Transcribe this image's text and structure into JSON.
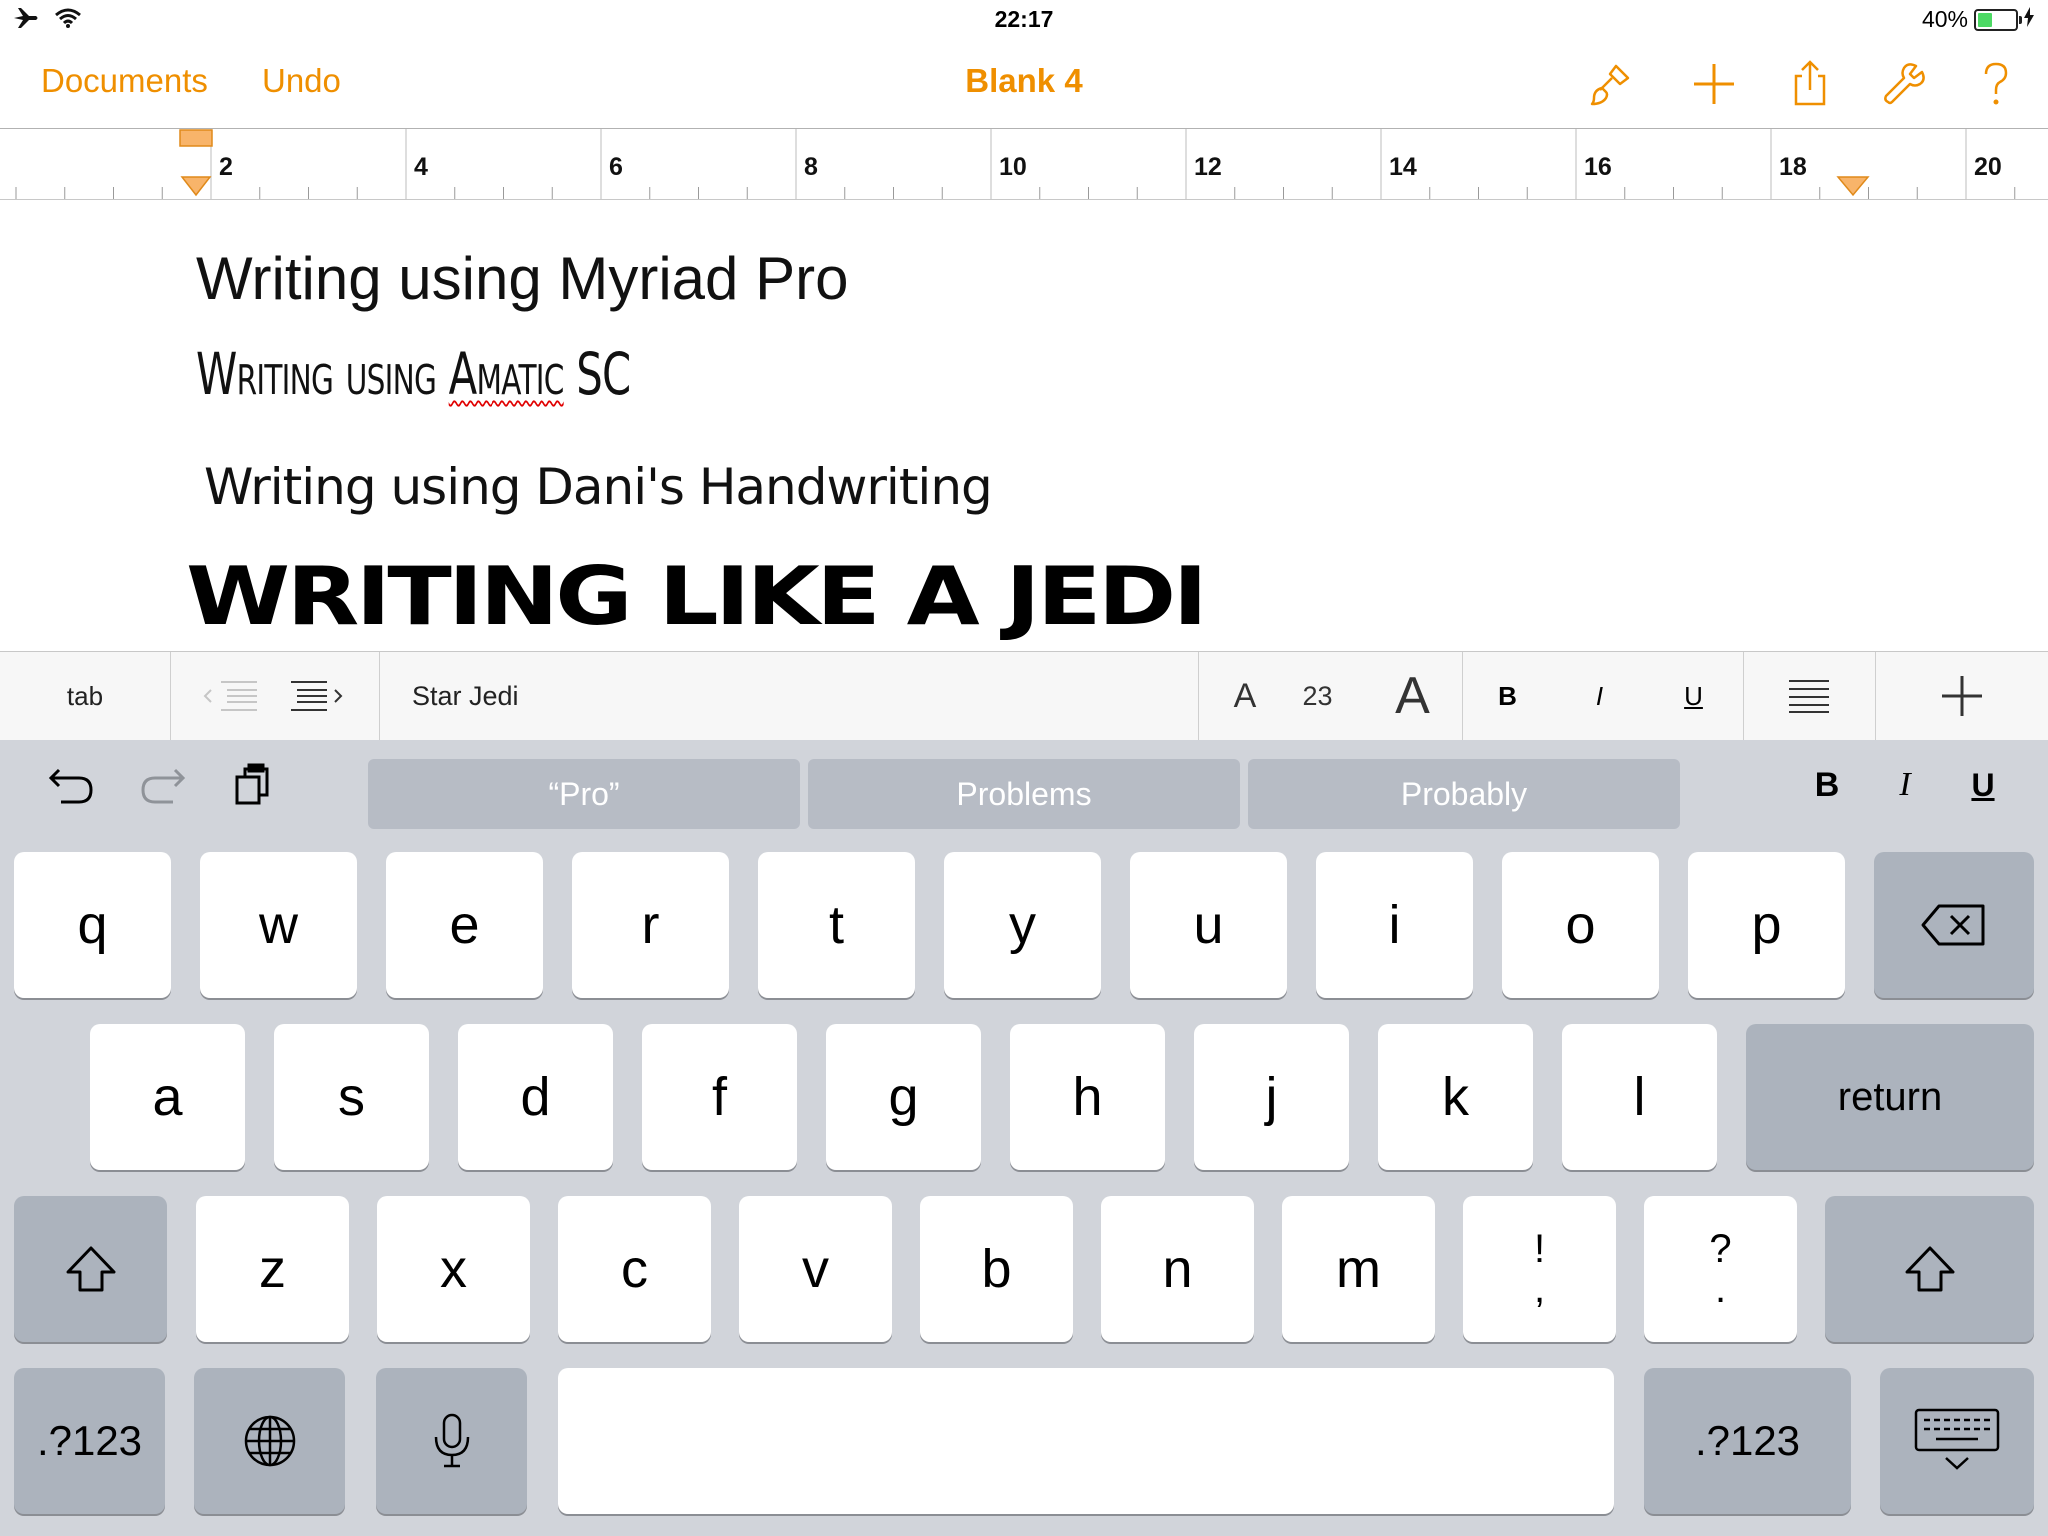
{
  "status_bar": {
    "time": "22:17",
    "battery_percent": "40%",
    "battery_level": 0.4
  },
  "nav": {
    "documents": "Documents",
    "undo": "Undo",
    "title": "Blank 4",
    "icons": [
      "paintbrush-icon",
      "plus-icon",
      "share-icon",
      "wrench-icon",
      "help-icon"
    ]
  },
  "ruler": {
    "labels": [
      "2",
      "4",
      "6",
      "8",
      "10",
      "12",
      "14",
      "16",
      "18",
      "20"
    ]
  },
  "document": {
    "line1": "Writing using Myriad Pro",
    "line2_pre": "Writing using ",
    "line2_misspelled": "Amatic",
    "line2_post": " SC",
    "line3": "Writing using Dani's Handwriting",
    "line4": "WRITING LIKE A JEDI"
  },
  "format_bar": {
    "tab": "tab",
    "font": "Star Jedi",
    "size_small": "A",
    "size": "23",
    "size_large": "A",
    "bold": "B",
    "italic": "I",
    "underline": "U"
  },
  "keyboard": {
    "suggestions": [
      "“Pro”",
      "Problems",
      "Probably"
    ],
    "format": {
      "bold": "B",
      "italic": "I",
      "underline": "U"
    },
    "row1": [
      "q",
      "w",
      "e",
      "r",
      "t",
      "y",
      "u",
      "i",
      "o",
      "p"
    ],
    "row2": [
      "a",
      "s",
      "d",
      "f",
      "g",
      "h",
      "j",
      "k",
      "l"
    ],
    "row3": [
      "z",
      "x",
      "c",
      "v",
      "b",
      "n",
      "m"
    ],
    "punct1_top": "!",
    "punct1_bottom": ",",
    "punct2_top": "?",
    "punct2_bottom": ".",
    "return": "return",
    "numbers": ".?123",
    "colors": {
      "key": "#ffffff",
      "key_dark": "#acb3bd",
      "background": "#d1d4da",
      "suggestion": "#b7bcc5"
    }
  },
  "colors": {
    "accent": "#ef8f00"
  }
}
